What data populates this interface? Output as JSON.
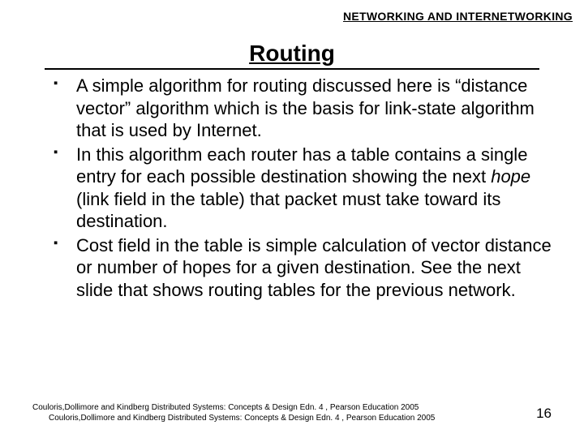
{
  "header": "NETWORKING AND INTERNETWORKING",
  "title": "Routing",
  "bullets": [
    {
      "text_before": "A simple algorithm for routing discussed here is “distance vector” algorithm which is the  basis for link-state algorithm that is used by Internet.",
      "italic": "",
      "text_after": ""
    },
    {
      "text_before": "In this algorithm each router has a table contains a single entry for each possible destination showing the next ",
      "italic": "hope",
      "text_after": " (link field in the table) that packet must take toward its destination."
    },
    {
      "text_before": "Cost field in the table is simple calculation of vector distance or number of hopes for a given destination. See the next slide that shows routing tables for the previous network.",
      "italic": "",
      "text_after": ""
    }
  ],
  "footer": {
    "line1": "Couloris,Dollimore and Kindberg  Distributed Systems: Concepts & Design  Edn. 4 ,  Pearson Education 2005",
    "line2": "Couloris,Dollimore and Kindberg  Distributed Systems: Concepts & Design  Edn. 4 ,  Pearson Education 2005"
  },
  "page_number": "16"
}
